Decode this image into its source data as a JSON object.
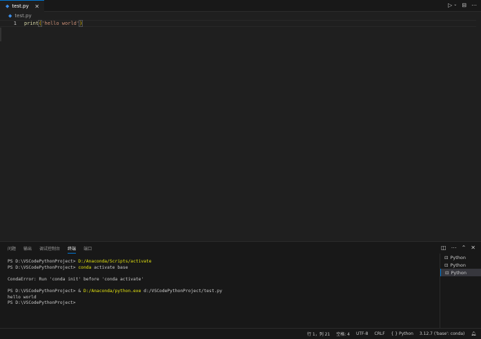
{
  "tab": {
    "icon": "python-file-icon",
    "name": "test.py",
    "close": "✕"
  },
  "breadcrumb": "test.py",
  "editor": {
    "line_number": "1",
    "code_fn": "print",
    "code_open": "(",
    "code_str": "'hello world'",
    "code_close": ")"
  },
  "panel": {
    "tabs": [
      "问题",
      "输出",
      "调试控制台",
      "终端",
      "端口"
    ],
    "active_tab": 3,
    "terminal": [
      {
        "prefix": "PS D:\\VSCodePythonProject> ",
        "hl": "D:/Anaconda/Scripts/activate",
        "rest": ""
      },
      {
        "prefix": "PS D:\\VSCodePythonProject> ",
        "hl": "conda",
        "rest": " activate base"
      },
      {
        "prefix": "",
        "hl": "",
        "rest": ""
      },
      {
        "prefix": "CondaError: Run 'conda init' before 'conda activate'",
        "hl": "",
        "rest": ""
      },
      {
        "prefix": "",
        "hl": "",
        "rest": ""
      },
      {
        "prefix": "PS D:\\VSCodePythonProject> & ",
        "hl": "D:/Anaconda/python.exe",
        "rest": " d:/VSCodePythonProject/test.py"
      },
      {
        "prefix": "hello world",
        "hl": "",
        "rest": ""
      },
      {
        "prefix": "PS D:\\VSCodePythonProject> ",
        "hl": "",
        "rest": ""
      }
    ],
    "terminals": [
      "Python",
      "Python",
      "Python"
    ]
  },
  "status": {
    "position": "行 1，列 21",
    "spaces": "空格: 4",
    "encoding": "UTF-8",
    "eol": "CRLF",
    "language": "{ } Python",
    "interpreter": "3.12.7 ('base': conda)"
  }
}
